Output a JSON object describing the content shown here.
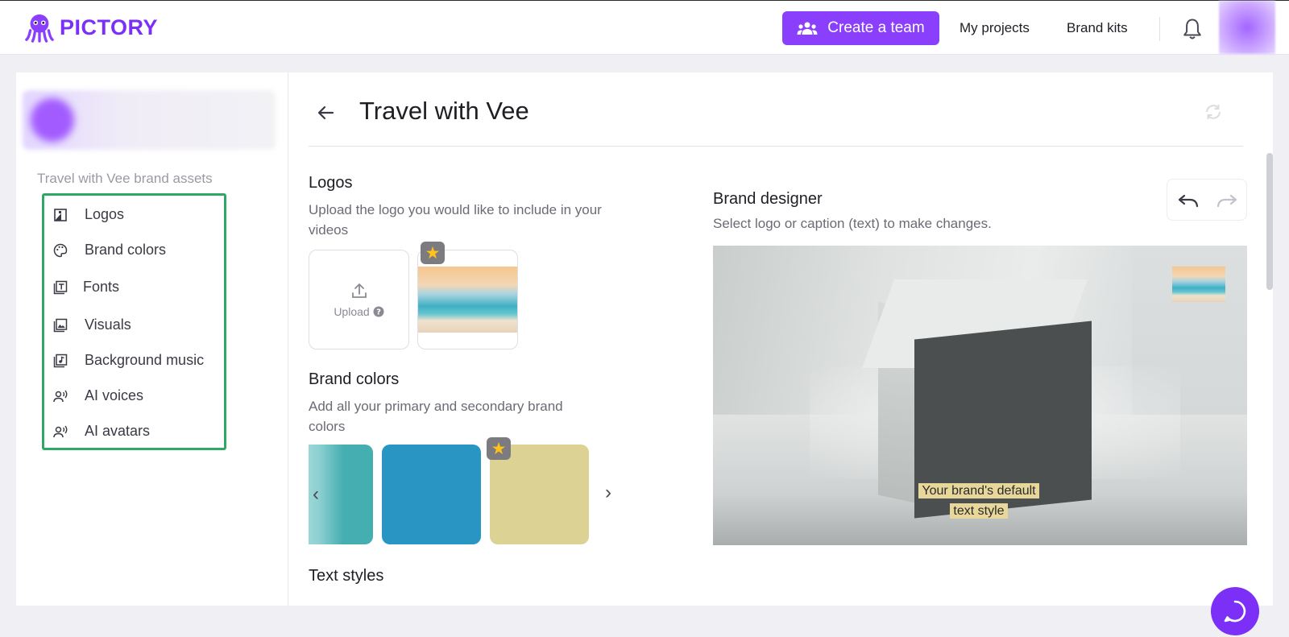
{
  "brand": {
    "name": "PICTORY",
    "accent": "#8a3ffc"
  },
  "nav": {
    "create_team": "Create a team",
    "my_projects": "My projects",
    "brand_kits": "Brand kits"
  },
  "sidebar": {
    "assets_title": "Travel with Vee brand assets",
    "items": [
      {
        "label": "Logos",
        "icon": "logo-image-icon"
      },
      {
        "label": "Brand colors",
        "icon": "palette-icon"
      },
      {
        "label": "Fonts",
        "icon": "font-icon"
      },
      {
        "label": "Visuals",
        "icon": "visuals-icon"
      },
      {
        "label": "Background music",
        "icon": "music-icon"
      },
      {
        "label": "AI voices",
        "icon": "voice-icon"
      },
      {
        "label": "AI avatars",
        "icon": "avatar-voice-icon"
      }
    ],
    "highlight_color": "#2fa866"
  },
  "main": {
    "title": "Travel with Vee",
    "logos": {
      "title": "Logos",
      "desc_line1": "Upload the logo you would like to include in your",
      "desc_line2": "videos",
      "upload_label": "Upload"
    },
    "brand_colors": {
      "title": "Brand colors",
      "desc_line1": "Add all your primary and secondary brand",
      "desc_line2": "colors",
      "swatches": [
        "#45aeb0",
        "#2895c2",
        "#dbd293"
      ]
    },
    "text_styles": {
      "title": "Text styles"
    },
    "designer": {
      "title": "Brand designer",
      "desc": "Select logo or caption (text) to make changes.",
      "caption_line1": "Your brand's default",
      "caption_line2": "text style"
    }
  }
}
